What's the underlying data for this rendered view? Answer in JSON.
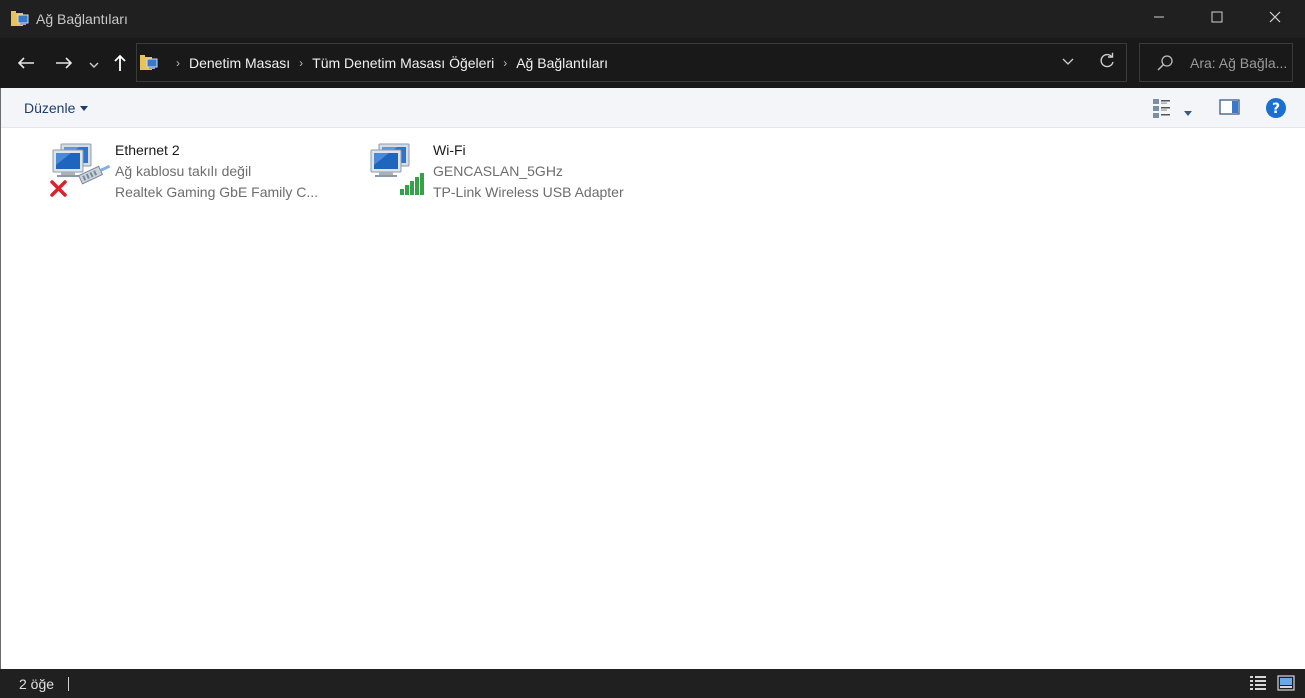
{
  "window": {
    "title": "Ağ Bağlantıları",
    "controls": {
      "minimize_icon": "minimize-icon",
      "maximize_icon": "maximize-icon",
      "close_icon": "close-icon"
    }
  },
  "nav": {
    "breadcrumbs": [
      "Denetim Masası",
      "Tüm Denetim Masası Öğeleri",
      "Ağ Bağlantıları"
    ],
    "search_placeholder": "Ara: Ağ Bağla..."
  },
  "commandbar": {
    "organize_label": "Düzenle"
  },
  "items": [
    {
      "name": "Ethernet 2",
      "status": "Ağ kablosu takılı değil",
      "device": "Realtek Gaming GbE Family C...",
      "icon": "ethernet-disconnected-icon"
    },
    {
      "name": "Wi-Fi",
      "status": "GENCASLAN_5GHz",
      "device": "TP-Link Wireless USB Adapter",
      "icon": "wifi-signal-icon"
    }
  ],
  "statusbar": {
    "count": "2 öğe"
  },
  "colors": {
    "titlebar": "#202020",
    "navbar": "#191919",
    "commandbar": "#f3f5f8",
    "accent": "#1e3d6b",
    "help": "#1a6fd0"
  }
}
